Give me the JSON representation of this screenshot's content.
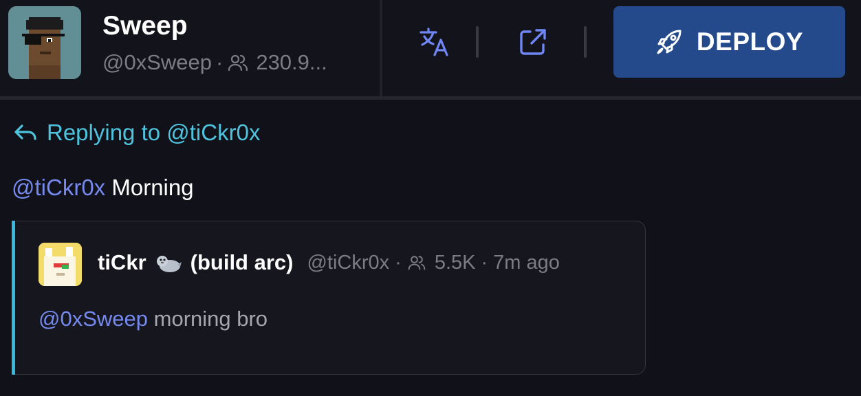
{
  "header": {
    "name": "Sweep",
    "handle": "@0xSweep",
    "separator": "·",
    "followers": "230.9...",
    "deploy_label": "DEPLOY"
  },
  "icons": {
    "translate": "translate-icon",
    "external": "external-link-icon",
    "rocket": "rocket-icon",
    "reply": "reply-arrow-icon",
    "users": "users-icon",
    "seal": "seal-emoji-icon"
  },
  "reply": {
    "label": "Replying to @tiCkr0x"
  },
  "message": {
    "mention": "@tiCkr0x",
    "text": "Morning"
  },
  "quoted": {
    "name": "tiCkr",
    "tag": "(build arc)",
    "handle": "@tiCkr0x",
    "separator": "·",
    "followers": "5.5K",
    "time": "7m ago",
    "mention": "@0xSweep",
    "text": "morning bro"
  },
  "colors": {
    "background": "#111119",
    "accent_cyan": "#35b9dc",
    "mention": "#7689ee",
    "deploy_bg": "#254a8c"
  }
}
